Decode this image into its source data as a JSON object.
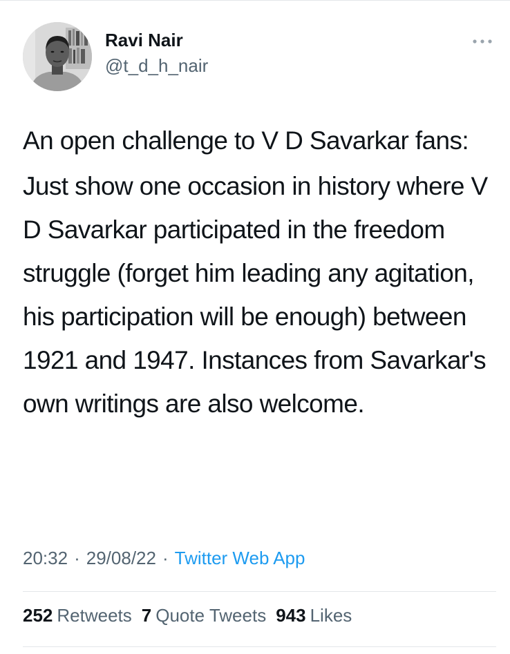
{
  "author": {
    "name": "Ravi Nair",
    "handle": "@t_d_h_nair"
  },
  "tweet": {
    "paragraphs": [
      "An open challenge to V D Savarkar fans:",
      "Just show one occasion in history where V D Savarkar participated in the freedom struggle (forget him leading any agitation, his participation will be enough) between 1921 and 1947. Instances from Savarkar's own writings are also welcome."
    ],
    "time": "20:32",
    "date": "29/08/22",
    "separator": "·",
    "source": "Twitter Web App"
  },
  "stats": {
    "retweets_count": "252",
    "retweets_label": "Retweets",
    "quotes_count": "7",
    "quotes_label": "Quote Tweets",
    "likes_count": "943",
    "likes_label": "Likes"
  },
  "icons": {
    "more": "more-horizontal-icon"
  },
  "colors": {
    "text": "#0f1419",
    "secondary": "#536471",
    "link": "#1d9bf0",
    "divider": "#e3e6e9"
  }
}
